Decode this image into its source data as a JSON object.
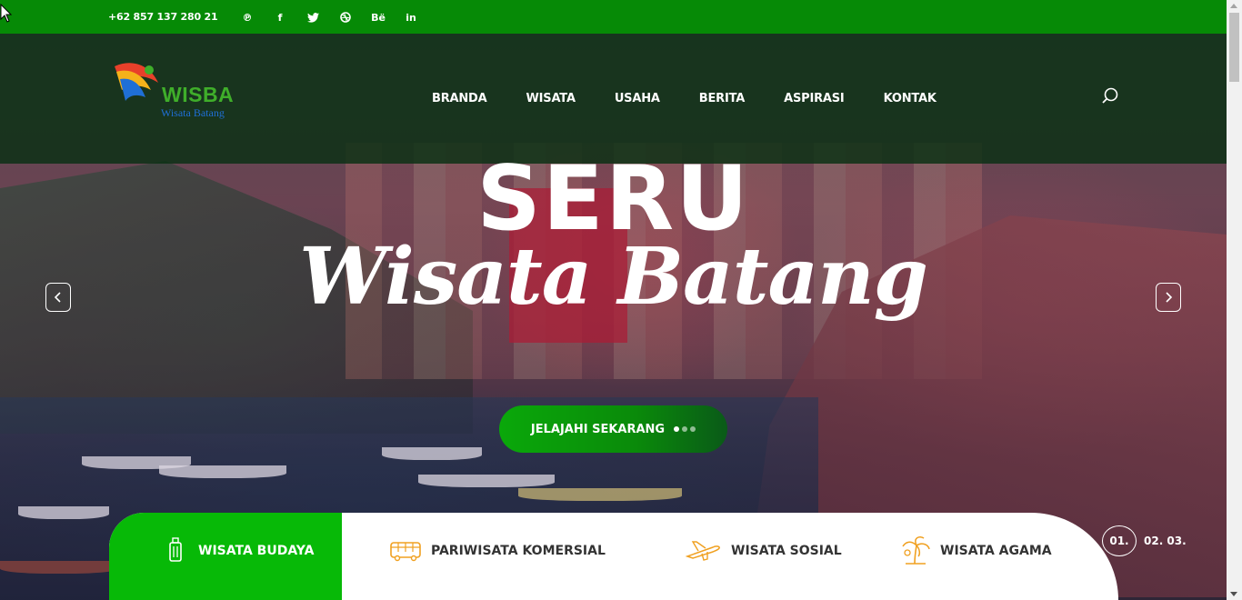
{
  "topbar": {
    "phone": "+62 857 137 280 21",
    "social": [
      {
        "icon": "pinterest-icon",
        "glyph": "℗"
      },
      {
        "icon": "facebook-icon",
        "glyph": "f"
      },
      {
        "icon": "twitter-icon",
        "glyph": "❀"
      },
      {
        "icon": "dribbble-icon",
        "glyph": "◎"
      },
      {
        "icon": "behance-icon",
        "glyph": "Bë"
      },
      {
        "icon": "linkedin-icon",
        "glyph": "in"
      }
    ],
    "color": "#068a06"
  },
  "header": {
    "logo_text": "WISBA",
    "logo_sub": "Wisata Batang",
    "nav": [
      "BRANDA",
      "WISATA",
      "USAHA",
      "BERITA",
      "ASPIRASI",
      "KONTAK"
    ],
    "search_icon": "search-icon"
  },
  "hero": {
    "headline": "SERU",
    "script": "Wisata Batang",
    "cta_label": "JELAJAHI SEKARANG",
    "prev_icon": "chevron-left-icon",
    "next_icon": "chevron-right-icon"
  },
  "tabs": [
    {
      "label": "WISATA BUDAYA",
      "icon": "luggage-icon",
      "active": true
    },
    {
      "label": "PARIWISATA KOMERSIAL",
      "icon": "bus-icon",
      "active": false
    },
    {
      "label": "WISATA SOSIAL",
      "icon": "airplane-icon",
      "active": false
    },
    {
      "label": "WISATA AGAMA",
      "icon": "palm-tree-icon",
      "active": false
    }
  ],
  "pager": {
    "current": "01.",
    "rest": "02. 03."
  },
  "colors": {
    "accent": "#07b907",
    "icon_orange": "#f0a020"
  }
}
